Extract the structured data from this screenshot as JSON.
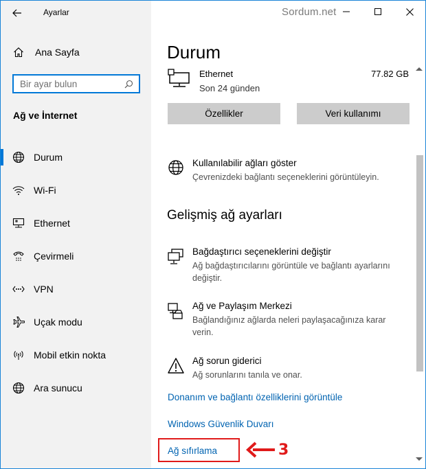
{
  "window": {
    "app_title": "Ayarlar",
    "watermark": "Sordum.net",
    "controls": [
      "minimize",
      "maximize",
      "close"
    ]
  },
  "sidebar": {
    "home_label": "Ana Sayfa",
    "search_placeholder": "Bir ayar bulun",
    "section_title": "Ağ ve İnternet",
    "items": [
      {
        "label": "Durum",
        "icon": "globe-icon",
        "active": true
      },
      {
        "label": "Wi-Fi",
        "icon": "wifi-icon",
        "active": false
      },
      {
        "label": "Ethernet",
        "icon": "ethernet-icon",
        "active": false
      },
      {
        "label": "Çevirmeli",
        "icon": "dialup-icon",
        "active": false
      },
      {
        "label": "VPN",
        "icon": "vpn-icon",
        "active": false
      },
      {
        "label": "Uçak modu",
        "icon": "airplane-icon",
        "active": false
      },
      {
        "label": "Mobil etkin nokta",
        "icon": "hotspot-icon",
        "active": false
      },
      {
        "label": "Ara sunucu",
        "icon": "globe-icon",
        "active": false
      }
    ]
  },
  "main": {
    "title": "Durum",
    "ethernet": {
      "name": "Ethernet",
      "subtitle": "Son 24 günden",
      "usage": "77.82 GB"
    },
    "buttons": {
      "properties": "Özellikler",
      "data_usage": "Veri kullanımı"
    },
    "show_networks": {
      "title": "Kullanılabilir ağları göster",
      "desc": "Çevrenizdeki bağlantı seçeneklerini görüntüleyin."
    },
    "advanced_heading": "Gelişmiş ağ ayarları",
    "settings": [
      {
        "title": "Bağdaştırıcı seçeneklerini değiştir",
        "desc": "Ağ bağdaştırıcılarını görüntüle ve bağlantı ayarlarını değiştir."
      },
      {
        "title": "Ağ ve Paylaşım Merkezi",
        "desc": "Bağlandığınız ağlarda neleri paylaşacağınıza karar verin."
      },
      {
        "title": "Ağ sorun giderici",
        "desc": "Ağ sorunlarını tanıla ve onar."
      }
    ],
    "links": {
      "hardware": "Donanım ve bağlantı özelliklerini görüntüle",
      "firewall": "Windows Güvenlik Duvarı",
      "reset": "Ağ sıfırlama"
    }
  },
  "annotation": {
    "step": "3",
    "color": "#e01a1a"
  },
  "colors": {
    "accent": "#0078d7",
    "link": "#0063b1",
    "sidebar_bg": "#f2f2f2"
  }
}
